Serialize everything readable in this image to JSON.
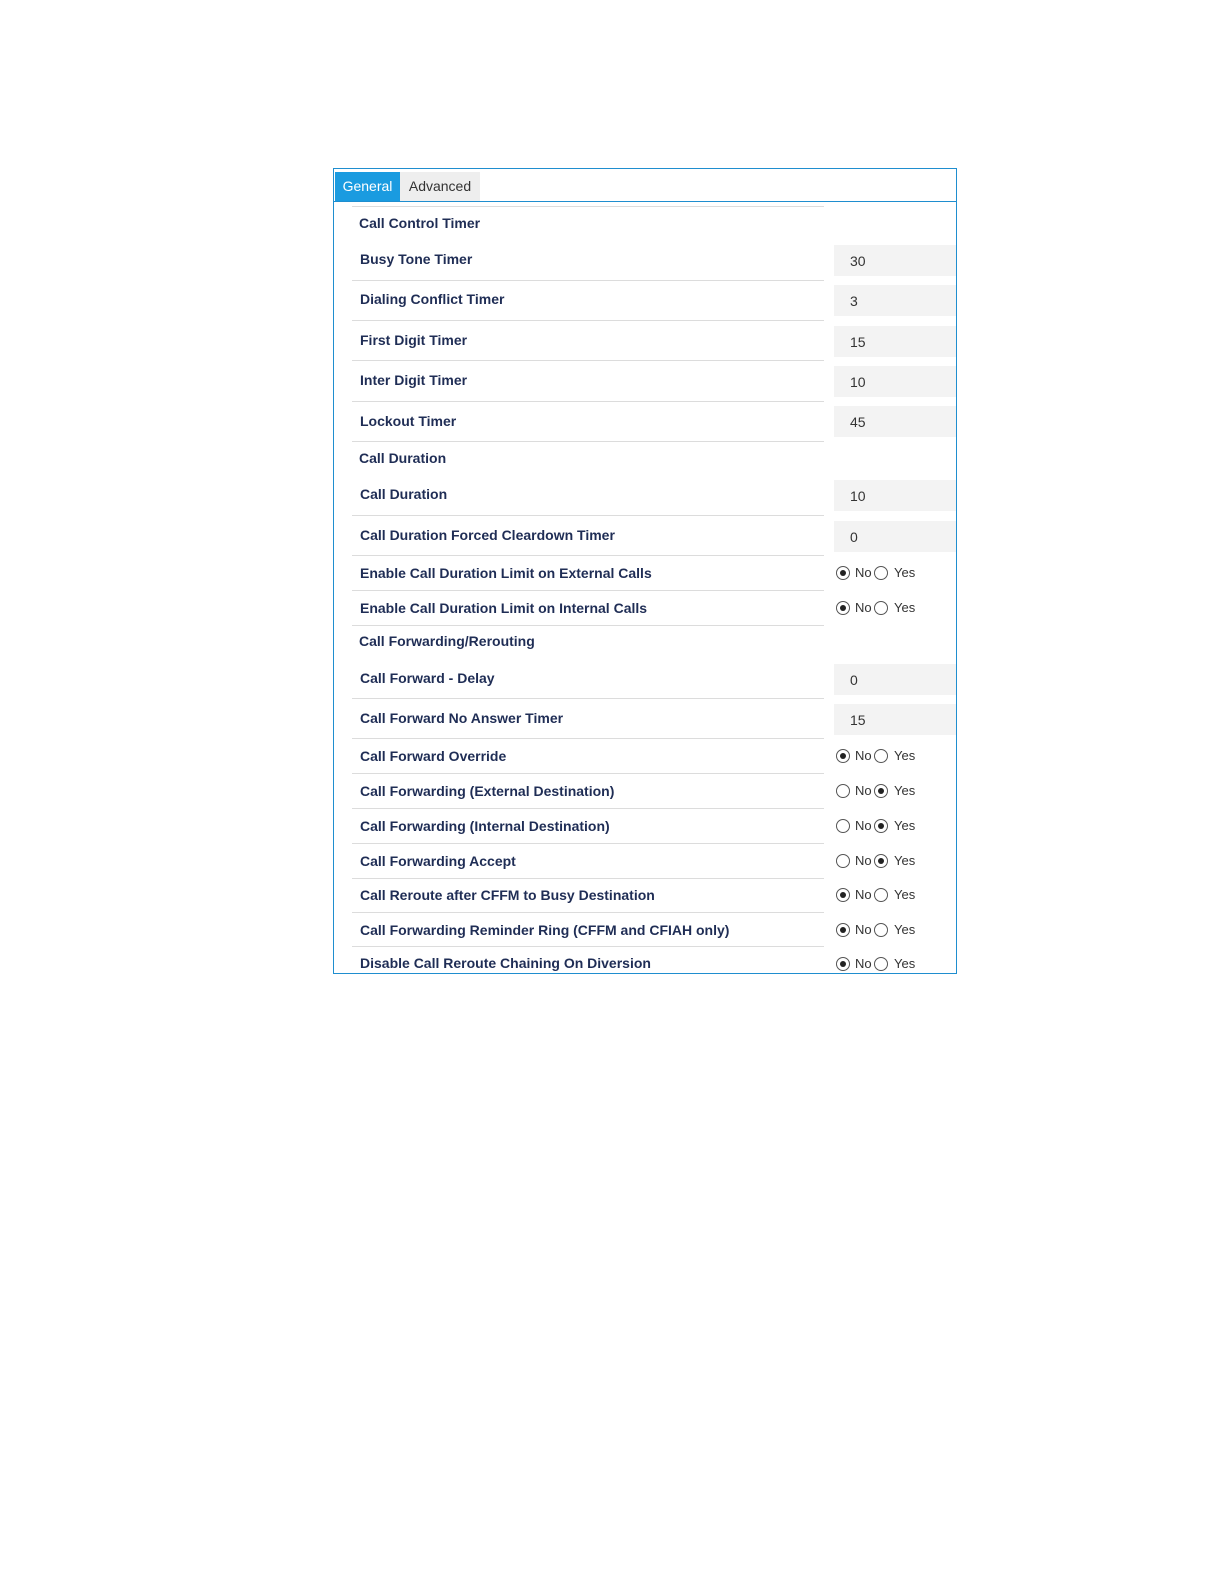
{
  "tabs": [
    {
      "label": "General",
      "active": true
    },
    {
      "label": "Advanced",
      "active": false
    }
  ],
  "sections": {
    "call_control_timer": "Call Control Timer",
    "call_duration": "Call Duration",
    "call_forwarding": "Call Forwarding/Rerouting"
  },
  "fields": {
    "busy_tone_timer": {
      "label": "Busy Tone Timer",
      "value": "30"
    },
    "dialing_conflict_timer": {
      "label": "Dialing Conflict Timer",
      "value": "3"
    },
    "first_digit_timer": {
      "label": "First Digit Timer",
      "value": "15"
    },
    "inter_digit_timer": {
      "label": "Inter Digit Timer",
      "value": "10"
    },
    "lockout_timer": {
      "label": "Lockout Timer",
      "value": "45"
    },
    "call_duration": {
      "label": "Call Duration",
      "value": "10"
    },
    "call_duration_forced_cleardown_timer": {
      "label": "Call Duration Forced Cleardown Timer",
      "value": "0"
    },
    "call_forward_delay": {
      "label": "Call Forward - Delay",
      "value": "0"
    },
    "call_forward_no_answer_timer": {
      "label": "Call Forward No Answer Timer",
      "value": "15"
    }
  },
  "radio_options": {
    "no": "No",
    "yes": "Yes"
  },
  "toggles": {
    "enable_limit_external": {
      "label": "Enable Call Duration Limit on External Calls",
      "selected": "No"
    },
    "enable_limit_internal": {
      "label": "Enable Call Duration Limit on Internal Calls",
      "selected": "No"
    },
    "call_forward_override": {
      "label": "Call Forward Override",
      "selected": "No"
    },
    "call_forwarding_external": {
      "label": "Call Forwarding (External Destination)",
      "selected": "Yes"
    },
    "call_forwarding_internal": {
      "label": "Call Forwarding (Internal Destination)",
      "selected": "Yes"
    },
    "call_forwarding_accept": {
      "label": "Call Forwarding Accept",
      "selected": "Yes"
    },
    "call_reroute_cffm_busy": {
      "label": "Call Reroute after CFFM to Busy Destination",
      "selected": "No"
    },
    "call_forwarding_reminder_ring": {
      "label": "Call Forwarding Reminder Ring (CFFM and CFIAH only)",
      "selected": "No"
    },
    "disable_call_reroute_chaining": {
      "label": "Disable Call Reroute Chaining On Diversion",
      "selected": "No"
    }
  }
}
